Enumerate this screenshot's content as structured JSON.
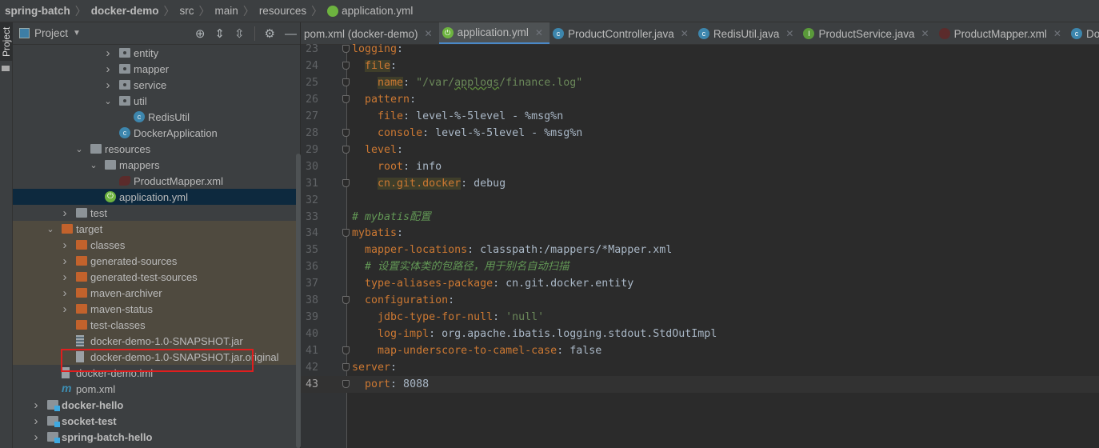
{
  "breadcrumb": [
    {
      "label": "spring-batch",
      "bold": true
    },
    {
      "label": "docker-demo",
      "bold": true
    },
    {
      "label": "src"
    },
    {
      "label": "main"
    },
    {
      "label": "resources"
    },
    {
      "label": "application.yml",
      "icon": "spring-icon"
    }
  ],
  "left_strip": {
    "label": "Project"
  },
  "project_panel": {
    "title": "Project",
    "icons": [
      "locate-icon",
      "expand-all-icon",
      "collapse-all-icon",
      "gear-icon",
      "minimize-icon"
    ]
  },
  "tree": [
    {
      "label": "entity",
      "level": 5,
      "arrow": "right",
      "icon": "package"
    },
    {
      "label": "mapper",
      "level": 5,
      "arrow": "right",
      "icon": "package"
    },
    {
      "label": "service",
      "level": 5,
      "arrow": "right",
      "icon": "package"
    },
    {
      "label": "util",
      "level": 5,
      "arrow": "down",
      "icon": "package"
    },
    {
      "label": "RedisUtil",
      "level": 6,
      "icon": "class"
    },
    {
      "label": "DockerApplication",
      "level": 5,
      "icon": "class"
    },
    {
      "label": "resources",
      "level": 3,
      "arrow": "down",
      "icon": "folder"
    },
    {
      "label": "mappers",
      "level": 4,
      "arrow": "down",
      "icon": "folder"
    },
    {
      "label": "ProductMapper.xml",
      "level": 5,
      "icon": "mybatis-xml"
    },
    {
      "label": "application.yml",
      "level": 4,
      "icon": "spring",
      "selected": true
    },
    {
      "label": "test",
      "level": 2,
      "arrow": "right",
      "icon": "folder"
    },
    {
      "label": "target",
      "level": 1,
      "arrow": "down",
      "icon": "folder-excluded",
      "target": true
    },
    {
      "label": "classes",
      "level": 2,
      "arrow": "right",
      "icon": "folder-excluded",
      "target": true
    },
    {
      "label": "generated-sources",
      "level": 2,
      "arrow": "right",
      "icon": "folder-excluded",
      "target": true
    },
    {
      "label": "generated-test-sources",
      "level": 2,
      "arrow": "right",
      "icon": "folder-excluded",
      "target": true
    },
    {
      "label": "maven-archiver",
      "level": 2,
      "arrow": "right",
      "icon": "folder-excluded",
      "target": true
    },
    {
      "label": "maven-status",
      "level": 2,
      "arrow": "right",
      "icon": "folder-excluded",
      "target": true
    },
    {
      "label": "test-classes",
      "level": 2,
      "icon": "folder-excluded",
      "target": true
    },
    {
      "label": "docker-demo-1.0-SNAPSHOT.jar",
      "level": 2,
      "icon": "jar",
      "target": true
    },
    {
      "label": "docker-demo-1.0-SNAPSHOT.jar.original",
      "level": 2,
      "icon": "file-unknown",
      "target": true
    },
    {
      "label": "docker-demo.iml",
      "level": 1,
      "icon": "iml"
    },
    {
      "label": "pom.xml",
      "level": 1,
      "icon": "maven"
    },
    {
      "label": "docker-hello",
      "level": 0,
      "arrow": "right",
      "icon": "module",
      "bold": true
    },
    {
      "label": "socket-test",
      "level": 0,
      "arrow": "right",
      "icon": "module",
      "bold": true
    },
    {
      "label": "spring-batch-hello",
      "level": 0,
      "arrow": "right",
      "icon": "module",
      "bold": true
    }
  ],
  "tabs": [
    {
      "label": "pom.xml (docker-demo)",
      "icon": "none"
    },
    {
      "label": "application.yml",
      "icon": "spring",
      "active": true
    },
    {
      "label": "ProductController.java",
      "icon": "class"
    },
    {
      "label": "RedisUtil.java",
      "icon": "class"
    },
    {
      "label": "ProductService.java",
      "icon": "interface"
    },
    {
      "label": "ProductMapper.xml",
      "icon": "mybatis-xml"
    },
    {
      "label": "DockerApplication.java",
      "icon": "class"
    }
  ],
  "colors": {
    "key": "#cc7832",
    "plain": "#a9b7c6",
    "string": "#6a8759",
    "comment": "#629755",
    "highlight_box": "#e01e1e",
    "selected_row": "#0d293e",
    "excluded_bg": "#4f4a3f"
  },
  "code": [
    {
      "n": "23",
      "fold": true,
      "t": [
        [
          "k",
          "logging"
        ],
        [
          "p",
          ":"
        ]
      ]
    },
    {
      "n": "24",
      "fold": true,
      "t": [
        [
          "p",
          "  "
        ],
        [
          "k hl",
          "file"
        ],
        [
          "p",
          ":"
        ]
      ]
    },
    {
      "n": "25",
      "fold": true,
      "t": [
        [
          "p",
          "    "
        ],
        [
          "k hl",
          "name"
        ],
        [
          "p",
          ": "
        ],
        [
          "s",
          "\"/var/"
        ],
        [
          "s sq",
          "applogs"
        ],
        [
          "s",
          "/finance.log\""
        ]
      ]
    },
    {
      "n": "26",
      "fold": true,
      "t": [
        [
          "p",
          "  "
        ],
        [
          "k",
          "pattern"
        ],
        [
          "p",
          ":"
        ]
      ]
    },
    {
      "n": "27",
      "t": [
        [
          "p",
          "    "
        ],
        [
          "k",
          "file"
        ],
        [
          "p",
          ": level-%-5level - %msg%n"
        ]
      ]
    },
    {
      "n": "28",
      "fold": true,
      "t": [
        [
          "p",
          "    "
        ],
        [
          "k",
          "console"
        ],
        [
          "p",
          ": level-%-5level - %msg%n"
        ]
      ]
    },
    {
      "n": "29",
      "fold": true,
      "t": [
        [
          "p",
          "  "
        ],
        [
          "k",
          "level"
        ],
        [
          "p",
          ":"
        ]
      ]
    },
    {
      "n": "30",
      "t": [
        [
          "p",
          "    "
        ],
        [
          "k",
          "root"
        ],
        [
          "p",
          ": info"
        ]
      ]
    },
    {
      "n": "31",
      "fold": true,
      "t": [
        [
          "p",
          "    "
        ],
        [
          "k hl",
          "cn.git.docker"
        ],
        [
          "p",
          ": debug"
        ]
      ]
    },
    {
      "n": "32",
      "t": []
    },
    {
      "n": "33",
      "t": [
        [
          "c",
          "# mybatis配置"
        ]
      ]
    },
    {
      "n": "34",
      "fold": true,
      "t": [
        [
          "k",
          "mybatis"
        ],
        [
          "p",
          ":"
        ]
      ]
    },
    {
      "n": "35",
      "t": [
        [
          "p",
          "  "
        ],
        [
          "k",
          "mapper-locations"
        ],
        [
          "p",
          ": classpath:/mappers/*Mapper.xml"
        ]
      ]
    },
    {
      "n": "36",
      "t": [
        [
          "p",
          "  "
        ],
        [
          "c",
          "# 设置实体类的包路径，用于别名自动扫描"
        ]
      ]
    },
    {
      "n": "37",
      "t": [
        [
          "p",
          "  "
        ],
        [
          "k",
          "type-aliases-package"
        ],
        [
          "p",
          ": cn.git.docker.entity"
        ]
      ]
    },
    {
      "n": "38",
      "fold": true,
      "t": [
        [
          "p",
          "  "
        ],
        [
          "k",
          "configuration"
        ],
        [
          "p",
          ":"
        ]
      ]
    },
    {
      "n": "39",
      "t": [
        [
          "p",
          "    "
        ],
        [
          "k",
          "jdbc-type-for-null"
        ],
        [
          "p",
          ": "
        ],
        [
          "s",
          "'null'"
        ]
      ]
    },
    {
      "n": "40",
      "t": [
        [
          "p",
          "    "
        ],
        [
          "k",
          "log-impl"
        ],
        [
          "p",
          ": org.apache.ibatis.logging.stdout.StdOutImpl"
        ]
      ]
    },
    {
      "n": "41",
      "fold": true,
      "t": [
        [
          "p",
          "    "
        ],
        [
          "k",
          "map-underscore-to-camel-case"
        ],
        [
          "p",
          ": false"
        ]
      ]
    },
    {
      "n": "42",
      "fold": true,
      "t": [
        [
          "k",
          "server"
        ],
        [
          "p",
          ":"
        ]
      ]
    },
    {
      "n": "43",
      "fold": true,
      "current": true,
      "t": [
        [
          "p",
          "  "
        ],
        [
          "k",
          "port"
        ],
        [
          "p",
          ": 8088"
        ]
      ]
    }
  ]
}
